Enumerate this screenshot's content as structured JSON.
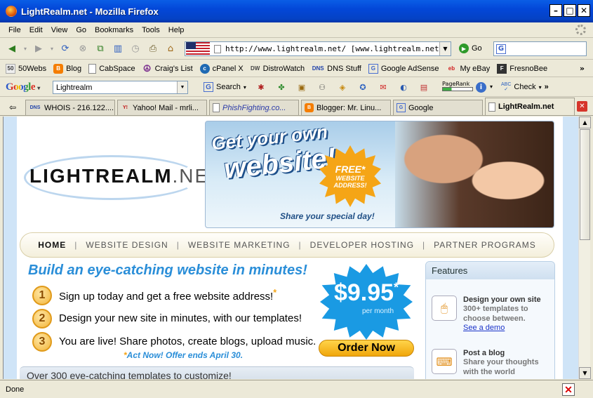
{
  "window": {
    "title": "LightRealm.net - Mozilla Firefox"
  },
  "menu": [
    "File",
    "Edit",
    "View",
    "Go",
    "Bookmarks",
    "Tools",
    "Help"
  ],
  "nav": {
    "url": "http://www.lightrealm.net/  [www.lightrealm.net]",
    "go_label": "Go"
  },
  "bookmarks": [
    "50Webs",
    "Blog",
    "CabSpace",
    "Craig's List",
    "cPanel X",
    "DistroWatch",
    "DNS Stuff",
    "Google AdSense",
    "My eBay",
    "FresnoBee"
  ],
  "google_toolbar": {
    "logo": "Google",
    "query": "Lightrealm",
    "search_label": "Search",
    "pagerank_label": "PageRank",
    "check_label": "Check",
    "abc": "ABC"
  },
  "tabs": [
    {
      "label": "WHOIS - 216.122....",
      "icon": "DNS"
    },
    {
      "label": "Yahoo! Mail - mrli...",
      "icon": "Y!"
    },
    {
      "label": "PhishFighting.co...",
      "icon": ""
    },
    {
      "label": "Blogger: Mr. Linu...",
      "icon": "B"
    },
    {
      "label": "Google",
      "icon": "G"
    },
    {
      "label": "LightRealm.net",
      "icon": "",
      "active": true
    }
  ],
  "site": {
    "logo_main": "LIGHTREALM",
    "logo_tld": ".NET",
    "banner": {
      "line1": "Get your own",
      "line2": "website!",
      "burst_line1": "FREE*",
      "burst_line2": "WEBSITE",
      "burst_line3": "ADDRESS!",
      "tagline": "Share your special day!"
    },
    "nav": [
      "HOME",
      "WEBSITE DESIGN",
      "WEBSITE MARKETING",
      "DEVELOPER HOSTING",
      "PARTNER PROGRAMS"
    ],
    "headline": "Build an eye-catching website in minutes!",
    "steps": [
      {
        "num": "1",
        "text": "Sign up today and get a free website address!"
      },
      {
        "num": "2",
        "text": "Design your new site in minutes, with our templates!"
      },
      {
        "num": "3",
        "text": "You are live! Share photos, create blogs, upload music."
      }
    ],
    "act_now": "Act Now! Offer ends April 30.",
    "price_main": "$9.95",
    "price_note": "per month",
    "order_label": "Order Now",
    "templates_strip": "Over 300 eye-catching templates to customize!",
    "features": {
      "title": "Features",
      "items": [
        {
          "title": "Design your own site",
          "desc": "300+ templates to choose between.",
          "link": "See a demo"
        },
        {
          "title": "Post a blog",
          "desc": "Share your thoughts with the world",
          "link": ""
        }
      ]
    }
  },
  "status": {
    "text": "Done"
  }
}
